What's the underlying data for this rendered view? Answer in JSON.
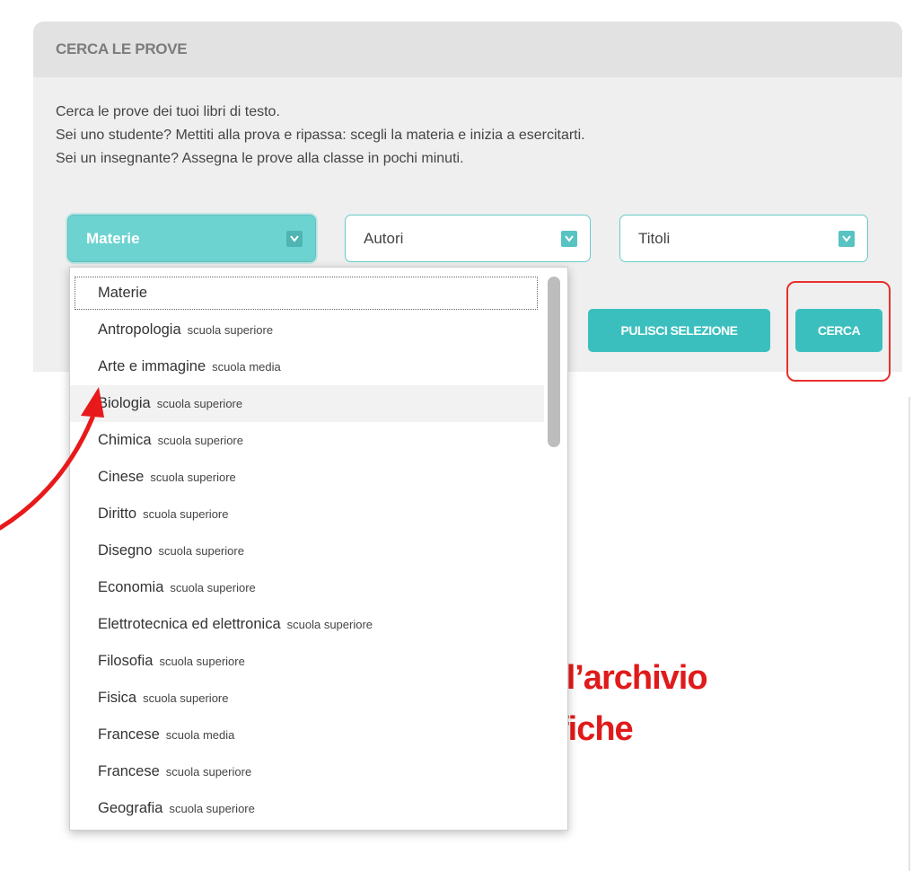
{
  "panel": {
    "title": "CERCA LE PROVE",
    "intro": [
      "Cerca le prove dei tuoi libri di testo.",
      "Sei uno studente? Mettiti alla prova e ripassa: scegli la materia e inizia a esercitarti.",
      "Sei un insegnante? Assegna le prove alla classe in pochi minuti."
    ]
  },
  "filters": {
    "materie": "Materie",
    "autori": "Autori",
    "titoli": "Titoli"
  },
  "buttons": {
    "clear": "PULISCI SELEZIONE",
    "search": "CERCA"
  },
  "background_text": {
    "line1": "ell’archivio",
    "line2": "fiche"
  },
  "dropdown": {
    "items": [
      {
        "name": "Materie",
        "level": ""
      },
      {
        "name": "Antropologia",
        "level": "scuola superiore"
      },
      {
        "name": "Arte e immagine",
        "level": "scuola media"
      },
      {
        "name": "Biologia",
        "level": "scuola superiore"
      },
      {
        "name": "Chimica",
        "level": "scuola superiore"
      },
      {
        "name": "Cinese",
        "level": "scuola superiore"
      },
      {
        "name": "Diritto",
        "level": "scuola superiore"
      },
      {
        "name": "Disegno",
        "level": "scuola superiore"
      },
      {
        "name": "Economia",
        "level": "scuola superiore"
      },
      {
        "name": "Elettrotecnica ed elettronica",
        "level": "scuola superiore"
      },
      {
        "name": "Filosofia",
        "level": "scuola superiore"
      },
      {
        "name": "Fisica",
        "level": "scuola superiore"
      },
      {
        "name": "Francese",
        "level": "scuola media"
      },
      {
        "name": "Francese",
        "level": "scuola superiore"
      },
      {
        "name": "Geografia",
        "level": "scuola superiore"
      }
    ]
  },
  "colors": {
    "accent": "#3bbfbe",
    "annotation": "#e8302d"
  }
}
